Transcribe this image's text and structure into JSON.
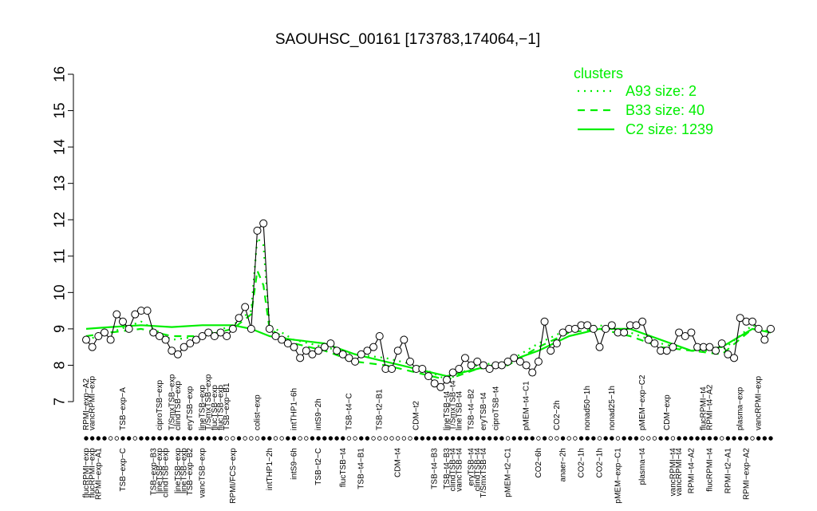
{
  "chart_data": {
    "type": "line",
    "title": "SAOUHSC_00161 [173783,174064,−1]",
    "xlabel": "",
    "ylabel": "",
    "ylim": [
      7,
      16
    ],
    "yticks": [
      "7",
      "8",
      "9",
      "10",
      "11",
      "12",
      "13",
      "14",
      "15",
      "16"
    ],
    "legend": {
      "title": "clusters",
      "position": "top-right",
      "entries": [
        {
          "label": "A93 size: 2",
          "style": "dotted"
        },
        {
          "label": "B33 size: 40",
          "style": "dashed"
        },
        {
          "label": "C2 size: 1239",
          "style": "solid"
        }
      ]
    },
    "colors": {
      "clusters": "#00ee00",
      "points": "#000000",
      "background": "#ffffff"
    },
    "top_labels": [
      {
        "x": 1,
        "text": "RPMI−exp−A2"
      },
      {
        "x": 2,
        "text": "vancRPMI−exp"
      },
      {
        "x": 7,
        "text": "TSB−exp−A"
      },
      {
        "x": 13,
        "text": "ciproTSB−exp"
      },
      {
        "x": 15,
        "text": "T/SmxTSB−exp"
      },
      {
        "x": 16,
        "text": "clindTSB−exp"
      },
      {
        "x": 18,
        "text": "eryTSB−exp"
      },
      {
        "x": 20,
        "text": "lineTSB−exp"
      },
      {
        "x": 21,
        "text": "T/SmxTSB−exp"
      },
      {
        "x": 22,
        "text": "flucTSB−exp"
      },
      {
        "x": 23,
        "text": "flucTSB−exp"
      },
      {
        "x": 24,
        "text": "TSB−exp−B1"
      },
      {
        "x": 29,
        "text": "colist−exp"
      },
      {
        "x": 35,
        "text": "intTHP1−6h"
      },
      {
        "x": 39,
        "text": "intS9−2h"
      },
      {
        "x": 44,
        "text": "TSB−t4−C"
      },
      {
        "x": 49,
        "text": "TSB−t2−B1"
      },
      {
        "x": 55,
        "text": "CDM−t2"
      },
      {
        "x": 60,
        "text": "lineTSB−t4"
      },
      {
        "x": 61,
        "text": "T/SmxTSB−t4"
      },
      {
        "x": 62,
        "text": "lineTSB−t4"
      },
      {
        "x": 64,
        "text": "TSB−t4−B2"
      },
      {
        "x": 66,
        "text": "eryTSB−t4"
      },
      {
        "x": 68,
        "text": "ciproTSB−t4"
      },
      {
        "x": 73,
        "text": "pMEM−t4−C1"
      },
      {
        "x": 78,
        "text": "CO2−2h"
      },
      {
        "x": 83,
        "text": "nonad50−1h"
      },
      {
        "x": 87,
        "text": "nonad25−1h"
      },
      {
        "x": 92,
        "text": "pMEM−exp−C2"
      },
      {
        "x": 96,
        "text": "CDM−exp"
      },
      {
        "x": 102,
        "text": "flucRPMI−t4"
      },
      {
        "x": 103,
        "text": "RPMI−t4−A2"
      },
      {
        "x": 108,
        "text": "plasma−exp"
      },
      {
        "x": 111,
        "text": "vancRPMI−exp"
      }
    ],
    "bottom_labels": [
      {
        "x": 1,
        "text": "flucRPMI−exp"
      },
      {
        "x": 2,
        "text": "flucRPMI−exp"
      },
      {
        "x": 3,
        "text": "RPMI−exp−A1"
      },
      {
        "x": 7,
        "text": "TSB−exp−C"
      },
      {
        "x": 12,
        "text": "TSB−exp−B3"
      },
      {
        "x": 13,
        "text": "lineTSB−exp"
      },
      {
        "x": 14,
        "text": "clindTSB−exp"
      },
      {
        "x": 16,
        "text": "lineTSB−exp"
      },
      {
        "x": 17,
        "text": "lineTSB−exp"
      },
      {
        "x": 18,
        "text": "TSB−exp−B2"
      },
      {
        "x": 20,
        "text": "vancTSB−exp"
      },
      {
        "x": 25,
        "text": "RPMI/FCS−exp"
      },
      {
        "x": 31,
        "text": "intTHP1−2h"
      },
      {
        "x": 35,
        "text": "intS9−6h"
      },
      {
        "x": 39,
        "text": "TSB−t2−C"
      },
      {
        "x": 43,
        "text": "flucTSB−t4"
      },
      {
        "x": 46,
        "text": "TSB−t4−B1"
      },
      {
        "x": 52,
        "text": "CDM−t4"
      },
      {
        "x": 58,
        "text": "TSB−t4−B3"
      },
      {
        "x": 60,
        "text": "TSB−t4−B3"
      },
      {
        "x": 61,
        "text": "clindTSB−t4"
      },
      {
        "x": 62,
        "text": "vancTSB−t4"
      },
      {
        "x": 64,
        "text": "eryTSB−t4"
      },
      {
        "x": 65,
        "text": "clindTSB−t4"
      },
      {
        "x": 66,
        "text": "T/SmxTSB−t4"
      },
      {
        "x": 70,
        "text": "pMEM−t2−C1"
      },
      {
        "x": 75,
        "text": "CO2−6h"
      },
      {
        "x": 79,
        "text": "anaer−2h"
      },
      {
        "x": 82,
        "text": "CO2−1h"
      },
      {
        "x": 85,
        "text": "CO2−1h"
      },
      {
        "x": 88,
        "text": "pMEM−exp−C1"
      },
      {
        "x": 92,
        "text": "plasma−t4"
      },
      {
        "x": 97,
        "text": "vancRPMI−t4"
      },
      {
        "x": 98,
        "text": "vancRPMI−t4"
      },
      {
        "x": 100,
        "text": "RPMI−t4−A2"
      },
      {
        "x": 103,
        "text": "flucRPMI−t4"
      },
      {
        "x": 106,
        "text": "RPMI−t2−A1"
      },
      {
        "x": 109,
        "text": "RPMI−exp−A2"
      }
    ],
    "series": [
      {
        "name": "SAOUHSC_00161",
        "style": "points",
        "x": [
          1,
          2,
          3,
          4,
          5,
          6,
          7,
          8,
          9,
          10,
          11,
          12,
          13,
          14,
          15,
          16,
          17,
          18,
          19,
          20,
          21,
          22,
          23,
          24,
          25,
          26,
          27,
          28,
          29,
          30,
          31,
          32,
          33,
          34,
          35,
          36,
          37,
          38,
          39,
          40,
          41,
          42,
          43,
          44,
          45,
          46,
          47,
          48,
          49,
          50,
          51,
          52,
          53,
          54,
          55,
          56,
          57,
          58,
          59,
          60,
          61,
          62,
          63,
          64,
          65,
          66,
          67,
          68,
          69,
          70,
          71,
          72,
          73,
          74,
          75,
          76,
          77,
          78,
          79,
          80,
          81,
          82,
          83,
          84,
          85,
          86,
          87,
          88,
          89,
          90,
          91,
          92,
          93,
          94,
          95,
          96,
          97,
          98,
          99,
          100,
          101,
          102,
          103,
          104,
          105,
          106,
          107,
          108,
          109,
          110,
          111,
          112,
          113
        ],
        "y": [
          8.7,
          8.5,
          8.8,
          8.9,
          8.7,
          9.4,
          9.2,
          9.0,
          9.4,
          9.5,
          9.5,
          8.9,
          8.8,
          8.7,
          8.4,
          8.3,
          8.5,
          8.6,
          8.7,
          8.8,
          8.9,
          8.8,
          8.9,
          8.8,
          9.0,
          9.3,
          9.6,
          9.0,
          11.7,
          11.9,
          9.0,
          8.8,
          8.7,
          8.6,
          8.5,
          8.2,
          8.4,
          8.3,
          8.4,
          8.5,
          8.6,
          8.4,
          8.3,
          8.2,
          8.1,
          8.3,
          8.4,
          8.5,
          8.8,
          7.9,
          7.9,
          8.4,
          8.7,
          8.1,
          7.9,
          7.9,
          7.7,
          7.5,
          7.4,
          7.6,
          7.8,
          7.9,
          8.2,
          8.0,
          8.1,
          8.0,
          7.9,
          8.0,
          8.0,
          8.1,
          8.2,
          8.1,
          8.0,
          7.8,
          8.1,
          9.2,
          8.4,
          8.6,
          8.9,
          9.0,
          9.0,
          9.1,
          9.1,
          9.0,
          8.5,
          9.0,
          9.1,
          8.9,
          8.9,
          9.1,
          9.1,
          9.2,
          8.7,
          8.6,
          8.4,
          8.4,
          8.5,
          8.9,
          8.8,
          8.9,
          8.5,
          8.5,
          8.5,
          8.4,
          8.6,
          8.3,
          8.2,
          9.3,
          9.2,
          9.2,
          9.0,
          8.7,
          9.0
        ]
      },
      {
        "name": "C2 size: 1239",
        "style": "solid",
        "x": [
          1,
          5,
          10,
          15,
          20,
          25,
          28,
          31,
          35,
          40,
          45,
          50,
          55,
          60,
          65,
          70,
          75,
          80,
          85,
          90,
          95,
          100,
          105,
          110,
          113
        ],
        "y": [
          9.0,
          9.05,
          9.1,
          9.05,
          9.1,
          9.1,
          9.0,
          8.8,
          8.7,
          8.6,
          8.3,
          8.1,
          7.9,
          7.7,
          7.9,
          8.1,
          8.4,
          8.8,
          9.0,
          9.0,
          8.7,
          8.4,
          8.5,
          9.0,
          8.9
        ]
      },
      {
        "name": "B33 size: 40",
        "style": "dashed",
        "x": [
          1,
          5,
          10,
          15,
          20,
          25,
          28,
          29,
          30,
          31,
          35,
          40,
          45,
          50,
          55,
          60,
          65,
          70,
          75,
          80,
          85,
          90,
          95,
          100,
          105,
          110,
          113
        ],
        "y": [
          8.8,
          8.9,
          9.0,
          8.8,
          8.8,
          9.0,
          9.4,
          10.6,
          10.2,
          9.0,
          8.6,
          8.4,
          8.1,
          8.0,
          7.8,
          7.6,
          7.9,
          8.0,
          8.5,
          8.9,
          9.0,
          8.8,
          8.5,
          8.4,
          8.3,
          9.0,
          8.9
        ]
      },
      {
        "name": "A93 size: 2",
        "style": "dotted",
        "x": [
          1,
          5,
          10,
          15,
          20,
          25,
          28,
          29,
          30,
          31,
          35,
          40,
          45,
          50,
          55,
          60,
          65,
          70,
          75,
          80,
          85,
          90,
          95,
          100,
          105,
          110,
          113
        ],
        "y": [
          8.7,
          8.9,
          9.2,
          8.7,
          8.8,
          9.1,
          9.5,
          11.5,
          11.3,
          9.1,
          8.7,
          8.5,
          8.3,
          8.2,
          8.0,
          7.6,
          8.0,
          8.1,
          8.6,
          9.0,
          9.1,
          8.9,
          8.6,
          8.4,
          8.4,
          9.1,
          8.9
        ]
      }
    ],
    "bottom_point_styles": "o=open circle, f=filled circle",
    "bottom_points_row": "ffffooffoffffffffffffffoofoooffooffooffffffooffooooooofffffffffffffffoffffofoofoofffoffofffoooffofffffffoffffofff"
  }
}
